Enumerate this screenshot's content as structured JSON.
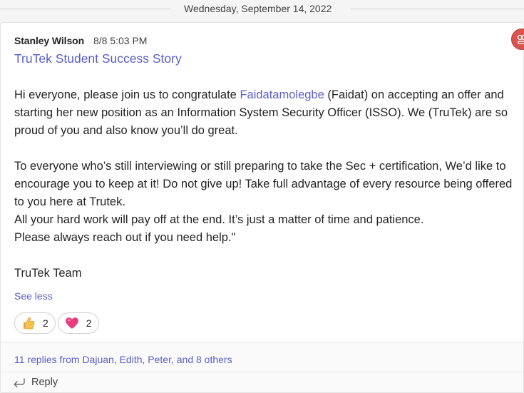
{
  "date_divider": "Wednesday, September 14, 2022",
  "message": {
    "author": "Stanley Wilson",
    "timestamp": "8/8 5:03 PM",
    "subject": "TruTek Student Success Story",
    "para1_pre": "Hi everyone, please join us to congratulate ",
    "mention": "Faidatamolegbe",
    "para1_post": " (Faidat) on accepting an offer and starting her new position as an Information System Security Officer (ISSO). We (TruTek) are so proud of you and also know you’ll do great.",
    "para2": "To everyone who’s still interviewing or still preparing to take the Sec + certification, We’d like to encourage you to keep at it! Do not give up! Take full advantage of every resource being offered to you here at Trutek.",
    "para3": "All your hard work will pay off at the end. It’s just a matter of time and patience.",
    "para4": "Please always reach out if you need help.\"",
    "signoff": "TruTek Team",
    "see_less": "See less"
  },
  "reactions": [
    {
      "icon": "thumbs-up-icon",
      "count": "2"
    },
    {
      "icon": "heart-icon",
      "count": "2"
    }
  ],
  "replies": {
    "summary": "11 replies from Dajuan, Edith, Peter, and 8 others",
    "reply_label": "Reply"
  },
  "colors": {
    "accent": "#5b5fc7",
    "badge": "#d9534f"
  }
}
